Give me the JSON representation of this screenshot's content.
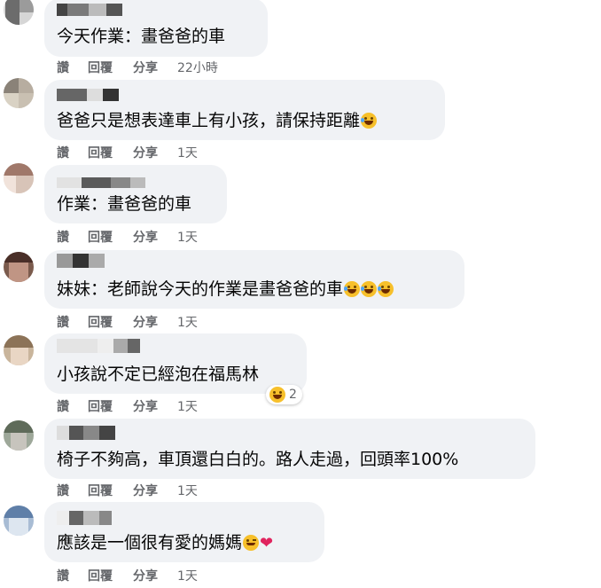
{
  "actions": {
    "like": "讚",
    "reply": "回覆",
    "share": "分享"
  },
  "comments": [
    {
      "text": "今天作業：畫爸爸的車",
      "time": "22小時"
    },
    {
      "text": "爸爸只是想表達車上有小孩，請保持距離",
      "time": "1天",
      "emoji": "rolling-laugh-emoji"
    },
    {
      "text": "作業：畫爸爸的車",
      "time": "1天"
    },
    {
      "text": "妹妹：老師說今天的作業是畫爸爸的車",
      "time": "1天",
      "emoji": "joy-emoji"
    },
    {
      "text": "小孩說不定已經泡在福馬林",
      "time": "1天",
      "reaction_count": "2"
    },
    {
      "text": "椅子不夠高，車頂還白白的。路人走過，回頭率100%",
      "time": "1天"
    },
    {
      "text": "應該是一個很有愛的媽媽",
      "time": "1天",
      "emoji": "wink-emoji, heart-icon"
    }
  ],
  "colors": {
    "bubble": "#f0f2f5",
    "text": "#050505",
    "meta": "#65676b",
    "emoji": "#f7c02b",
    "heart": "#e0245e"
  }
}
